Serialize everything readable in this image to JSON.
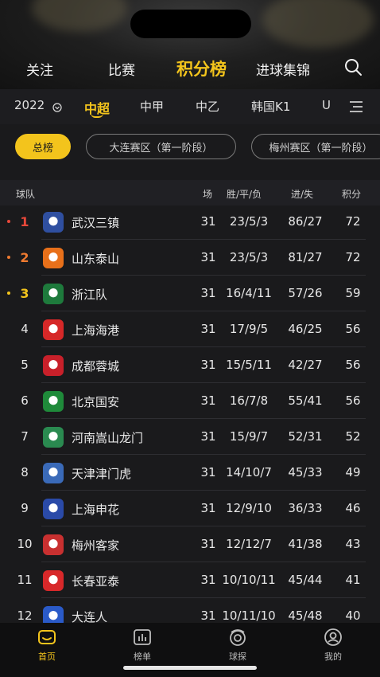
{
  "top_nav": {
    "items": [
      "关注",
      "比赛",
      "积分榜",
      "进球集锦"
    ],
    "active_index": 2
  },
  "league_bar": {
    "season": "2022",
    "tabs": [
      "中超",
      "中甲",
      "中乙",
      "韩国K1",
      "U"
    ],
    "active_index": 0
  },
  "filters": [
    "总榜",
    "大连赛区（第一阶段）",
    "梅州赛区（第一阶段）"
  ],
  "table": {
    "headers": {
      "team": "球队",
      "played": "场",
      "wdl": "胜/平/负",
      "goals": "进/失",
      "points": "积分"
    },
    "rows": [
      {
        "rank": "1",
        "team": "武汉三镇",
        "played": "31",
        "wdl": "23/5/3",
        "goals": "86/27",
        "points": "72",
        "rank_color": "#e8483a",
        "badge_color": "#2f4fa0"
      },
      {
        "rank": "2",
        "team": "山东泰山",
        "played": "31",
        "wdl": "23/5/3",
        "goals": "81/27",
        "points": "72",
        "rank_color": "#ee7a30",
        "badge_color": "#e8701a"
      },
      {
        "rank": "3",
        "team": "浙江队",
        "played": "31",
        "wdl": "16/4/11",
        "goals": "57/26",
        "points": "59",
        "rank_color": "#f3c41c",
        "badge_color": "#1e7a3c"
      },
      {
        "rank": "4",
        "team": "上海海港",
        "played": "31",
        "wdl": "17/9/5",
        "goals": "46/25",
        "points": "56",
        "rank_color": "#e8e8e8",
        "badge_color": "#d62828"
      },
      {
        "rank": "5",
        "team": "成都蓉城",
        "played": "31",
        "wdl": "15/5/11",
        "goals": "42/27",
        "points": "56",
        "rank_color": "#e8e8e8",
        "badge_color": "#c8202a"
      },
      {
        "rank": "6",
        "team": "北京国安",
        "played": "31",
        "wdl": "16/7/8",
        "goals": "55/41",
        "points": "56",
        "rank_color": "#e8e8e8",
        "badge_color": "#1f8a3a"
      },
      {
        "rank": "7",
        "team": "河南嵩山龙门",
        "played": "31",
        "wdl": "15/9/7",
        "goals": "52/31",
        "points": "52",
        "rank_color": "#e8e8e8",
        "badge_color": "#2a8a50"
      },
      {
        "rank": "8",
        "team": "天津津门虎",
        "played": "31",
        "wdl": "14/10/7",
        "goals": "45/33",
        "points": "49",
        "rank_color": "#e8e8e8",
        "badge_color": "#3a6ab8"
      },
      {
        "rank": "9",
        "team": "上海申花",
        "played": "31",
        "wdl": "12/9/10",
        "goals": "36/33",
        "points": "46",
        "rank_color": "#e8e8e8",
        "badge_color": "#2a4aa8"
      },
      {
        "rank": "10",
        "team": "梅州客家",
        "played": "31",
        "wdl": "12/12/7",
        "goals": "41/38",
        "points": "43",
        "rank_color": "#e8e8e8",
        "badge_color": "#c83030"
      },
      {
        "rank": "11",
        "team": "长春亚泰",
        "played": "31",
        "wdl": "10/10/11",
        "goals": "45/44",
        "points": "41",
        "rank_color": "#e8e8e8",
        "badge_color": "#d8282a"
      },
      {
        "rank": "12",
        "team": "大连人",
        "played": "31",
        "wdl": "10/11/10",
        "goals": "45/48",
        "points": "40",
        "rank_color": "#e8e8e8",
        "badge_color": "#2a5ac8"
      }
    ]
  },
  "bottom_nav": {
    "items": [
      "首页",
      "榜单",
      "球探",
      "我的"
    ],
    "active_index": 0
  },
  "colors": {
    "accent": "#f3c41c"
  }
}
